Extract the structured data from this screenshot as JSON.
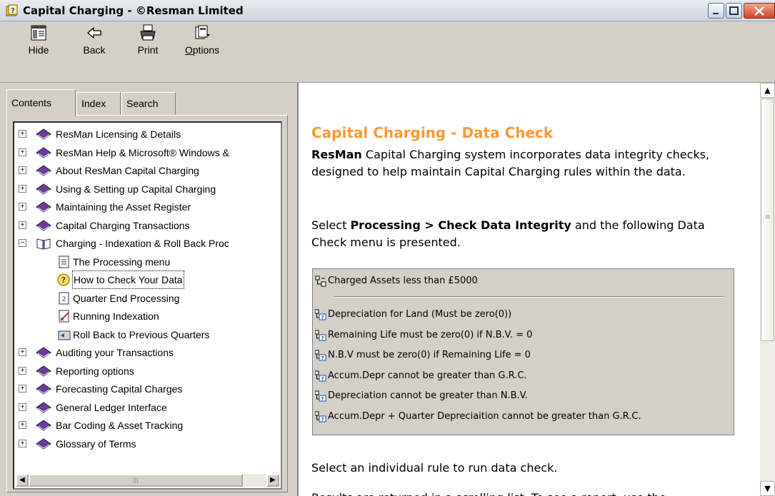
{
  "window": {
    "title": "Capital Charging - ©Resman Limited",
    "controls": [
      "minimize",
      "maximize",
      "close"
    ]
  },
  "toolbar": {
    "hide_label": "Hide",
    "back_label": "Back",
    "print_label": "Print",
    "options_label": "Options"
  },
  "tabs": {
    "contents": "Contents",
    "index": "Index",
    "search": "Search"
  },
  "tree": {
    "items": [
      {
        "label": "ResMan Licensing & Details",
        "type": "book"
      },
      {
        "label": "ResMan Help & Microsoft® Windows &",
        "type": "book"
      },
      {
        "label": "About ResMan Capital Charging",
        "type": "book"
      },
      {
        "label": "Using & Setting up Capital Charging",
        "type": "book"
      },
      {
        "label": "Maintaining the Asset Register",
        "type": "book"
      },
      {
        "label": "Capital Charging Transactions",
        "type": "book"
      },
      {
        "label": "Charging - Indexation & Roll Back Proc",
        "type": "book-open"
      },
      {
        "label": "The Processing menu",
        "type": "page"
      },
      {
        "label": "How to Check Your Data",
        "type": "page-help"
      },
      {
        "label": "Quarter End Processing",
        "type": "page-num"
      },
      {
        "label": "Running Indexation",
        "type": "page-edit"
      },
      {
        "label": "Roll Back to Previous Quarters",
        "type": "page-back"
      },
      {
        "label": "Auditing your Transactions",
        "type": "book"
      },
      {
        "label": "Reporting options",
        "type": "book"
      },
      {
        "label": "Forecasting Capital Charges",
        "type": "book"
      },
      {
        "label": "General Ledger Interface",
        "type": "book"
      },
      {
        "label": "Bar Coding & Asset Tracking",
        "type": "book"
      },
      {
        "label": "Glossary of Terms",
        "type": "book"
      }
    ],
    "selected": "How to Check Your Data"
  },
  "content": {
    "title": "Capital Charging - Data Check",
    "para1_bold": "ResMan",
    "para1_rest": " Capital Charging system incorporates data integrity checks, designed to help maintain Capital Charging rules within the data.",
    "para2_pre": "Select ",
    "para2_bold": "Processing > Check Data Integrity",
    "para2_post": " and the following Data Check menu is presented.",
    "menu": {
      "top_item": "Charged Assets less than £5000",
      "items": [
        "Depreciation for Land (Must be zero(0))",
        "Remaining Life must be zero(0) if N.B.V. = 0",
        "N.B.V must be zero(0)  if Remaining Life = 0",
        "Accum.Depr cannot be greater than G.R.C.",
        "Depreciation cannot be greater than N.B.V.",
        "Accum.Depr + Quarter Depreciaition cannot be greater than G.R.C."
      ]
    },
    "para3": "Select an individual rule to run data check.",
    "para4": "Results are returned in a scrolling list. To see a report, use the"
  }
}
